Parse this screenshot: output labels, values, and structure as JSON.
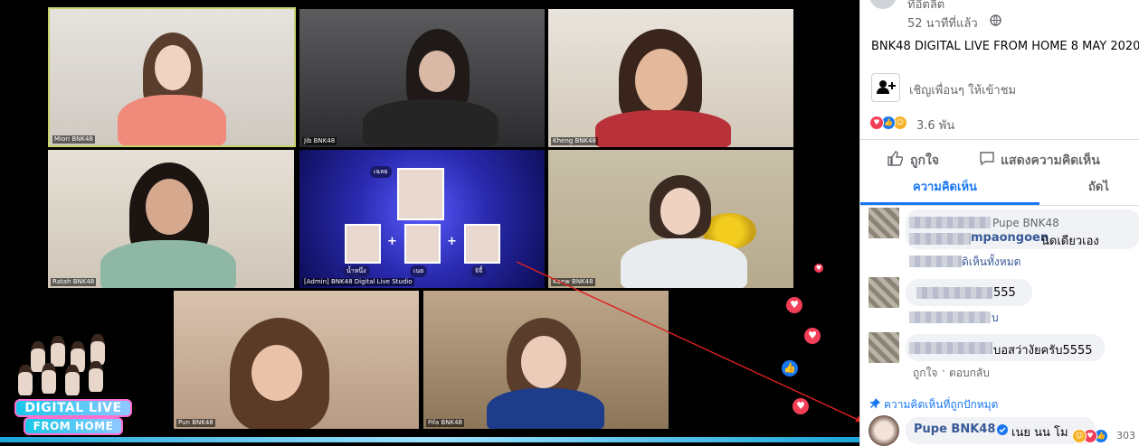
{
  "video": {
    "tiles": [
      {
        "key": "miori",
        "label": "Miori BNK48"
      },
      {
        "key": "jib",
        "label": "Jib BNK48"
      },
      {
        "key": "kheng",
        "label": "Kheng BNK48"
      },
      {
        "key": "ratah",
        "label": "Ratah BNK48"
      },
      {
        "key": "admin",
        "label": "[Admin] BNK48 Digital Live Studio"
      },
      {
        "key": "kaew",
        "label": "Kaew BNK48"
      },
      {
        "key": "pun",
        "label": "Pun BNK48"
      },
      {
        "key": "fifa",
        "label": "Fifa BNK48"
      }
    ],
    "studio": {
      "top_label": "เฉลย",
      "names": [
        "น้ำหนึ่ง",
        "เนย",
        "จิจี้"
      ]
    },
    "logo": {
      "line1": "DIGITAL LIVE",
      "line2": "FROM HOME"
    }
  },
  "post": {
    "author_partial": "ทีอีตลิต",
    "time": "52 นาทีที่แล้ว",
    "privacy_icon": "globe-icon",
    "title": "BNK48 DIGITAL LIVE FROM HOME 8 MAY 2020",
    "invite_label": "เชิญเพื่อนๆ ให้เข้าชม",
    "reaction_count": "3.6 พัน",
    "like_label": "ถูกใจ",
    "comment_label": "แสดงความคิดเห็น",
    "tabs": [
      "ความคิดเห็น",
      "ถัดไ"
    ]
  },
  "comments": [
    {
      "author": "Pupe BNK48",
      "text_partial": "mpaongoen",
      "text": "นิดเดียวเอง",
      "link": "ดิเห็นทั้งหมด"
    },
    {
      "text": "555",
      "link": "บ"
    },
    {
      "text": "บอสว่างัยครับ5555",
      "actions": [
        "ถูกใจ",
        "ตอบกลับ"
      ]
    }
  ],
  "pinned": {
    "label": "ความคิดเห็นที่ถูกปักหมุด",
    "author": "Pupe BNK48",
    "text": "เนย นน โม",
    "count": "303"
  },
  "colors": {
    "accent": "#1877f2",
    "heart": "#f33e58",
    "tile_border": "#c9d36b"
  }
}
